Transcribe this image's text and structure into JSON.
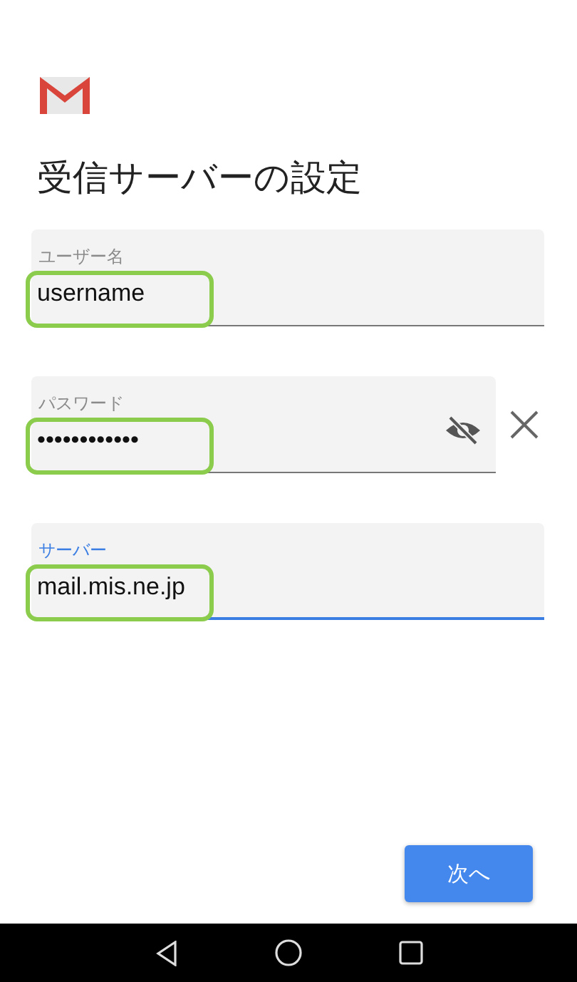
{
  "title": "受信サーバーの設定",
  "fields": [
    {
      "kind": "text",
      "label": "ユーザー名",
      "value": "username",
      "focused": false,
      "highlighted": true
    },
    {
      "kind": "password",
      "label": "パスワード",
      "value": "••••••••••••",
      "focused": false,
      "highlighted": true
    },
    {
      "kind": "text",
      "label": "サーバー",
      "value": "mail.mis.ne.jp",
      "focused": true,
      "highlighted": true
    }
  ],
  "next_button": "次へ"
}
